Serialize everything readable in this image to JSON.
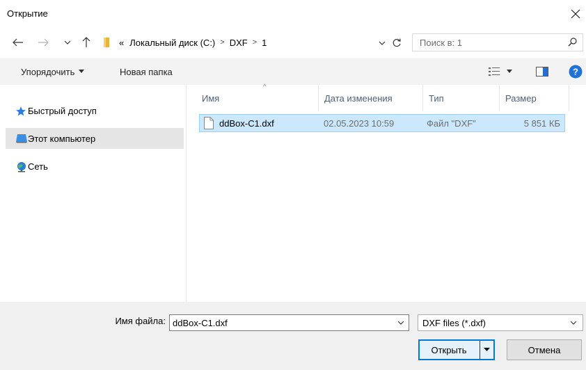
{
  "window": {
    "title": "Открытие"
  },
  "address": {
    "overflow": "«",
    "crumbs": [
      "Локальный диск (C:)",
      "DXF",
      "1"
    ]
  },
  "search": {
    "placeholder": "Поиск в: 1"
  },
  "toolbar": {
    "organize_label": "Упорядочить",
    "new_folder_label": "Новая папка"
  },
  "sidebar": {
    "items": [
      {
        "label": "Быстрый доступ",
        "icon": "star-icon"
      },
      {
        "label": "Этот компьютер",
        "icon": "computer-icon",
        "selected": true
      },
      {
        "label": "Сеть",
        "icon": "network-icon"
      }
    ]
  },
  "columns": {
    "name": "Имя",
    "date": "Дата изменения",
    "type": "Тип",
    "size": "Размер"
  },
  "files": [
    {
      "name": "ddBox-C1.dxf",
      "date": "02.05.2023 10:59",
      "type": "Файл \"DXF\"",
      "size": "5 851 КБ",
      "selected": true
    }
  ],
  "footer": {
    "filename_label": "Имя файла:",
    "filename_value": "ddBox-C1.dxf",
    "filetype_value": "DXF files (*.dxf)",
    "open_label": "Открыть",
    "cancel_label": "Отмена"
  },
  "colors": {
    "accent": "#0078d7",
    "selection": "#cce8ff",
    "help": "#1e73d4",
    "folder": "#e8b33a"
  }
}
